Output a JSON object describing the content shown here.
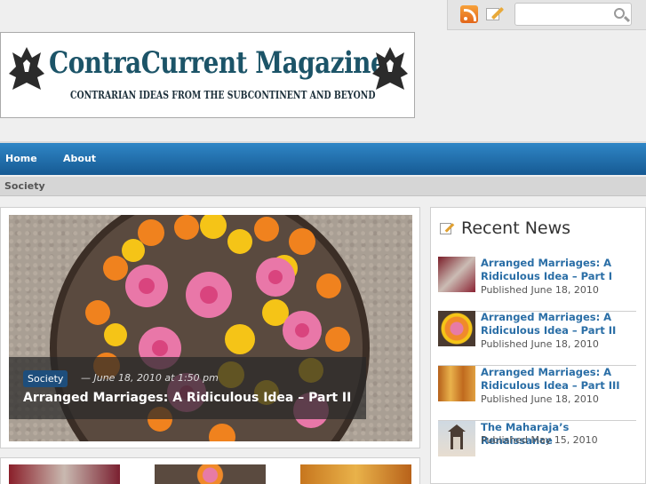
{
  "search": {
    "placeholder": ""
  },
  "header": {
    "title": "ContraCurrent Magazine",
    "tagline": "CONTRARIAN IDEAS FROM THE  SUBCONTINENT AND BEYOND"
  },
  "nav": {
    "items": [
      {
        "label": "Home"
      },
      {
        "label": "About"
      }
    ]
  },
  "breadcrumb": {
    "current": "Society"
  },
  "featured": {
    "category": "Society",
    "date": "— June 18, 2010 at 1:50 pm",
    "headline": "Arranged Marriages: A Ridiculous Idea – Part II"
  },
  "sidebar": {
    "heading": "Recent News",
    "items": [
      {
        "title": "Arranged Marriages: A Ridiculous Idea – Part I",
        "date": "Published June 18, 2010"
      },
      {
        "title": "Arranged Marriages: A Ridiculous Idea – Part II",
        "date": "Published June 18, 2010"
      },
      {
        "title": "Arranged Marriages: A Ridiculous Idea – Part III",
        "date": "Published June 18, 2010"
      },
      {
        "title": "The Maharaja’s Renaissance",
        "date": "Published May 15, 2010"
      }
    ]
  },
  "colors": {
    "brand": "#1c5468",
    "nav": "#1f6fae",
    "link": "#2a6ea6"
  }
}
